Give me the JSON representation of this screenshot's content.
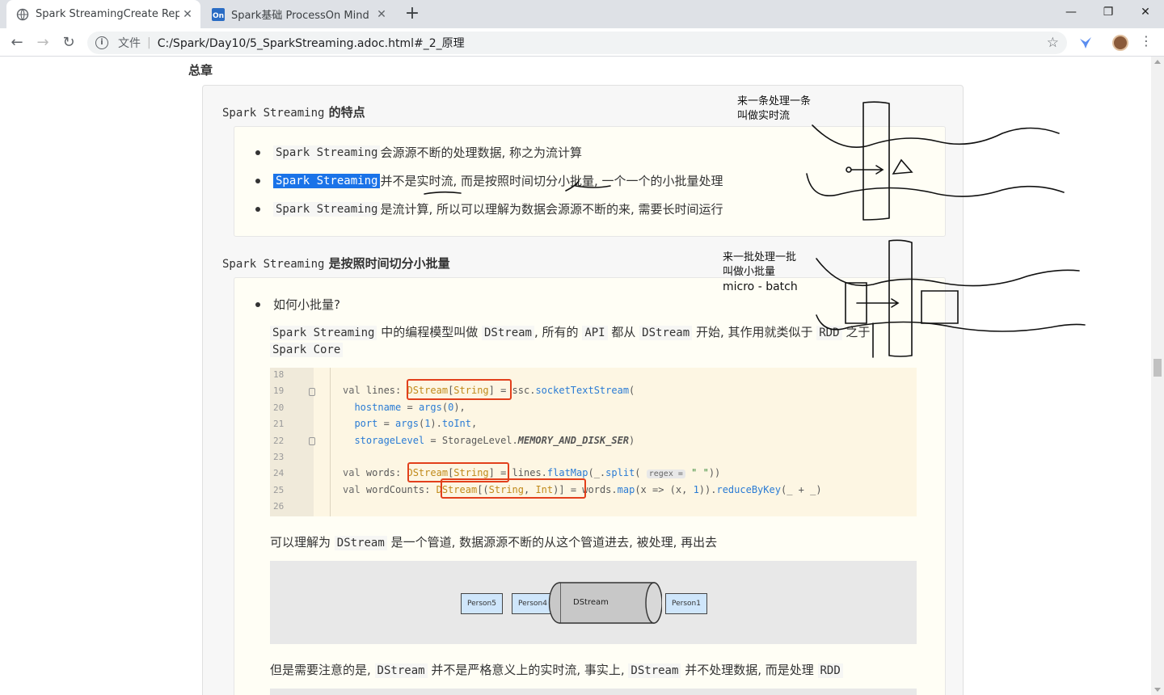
{
  "tabs": [
    {
      "title": "Spark StreamingCreate Reposi",
      "close": "✕"
    },
    {
      "title": "Spark基础 ProcessOn Mind",
      "close": "✕"
    }
  ],
  "newtab": "+",
  "window": {
    "min": "—",
    "max": "❐",
    "close": "✕"
  },
  "toolbar": {
    "file_label": "文件",
    "separator": "|",
    "url": "C:/Spark/Day10/5_SparkStreaming.adoc.html#_2_原理"
  },
  "page": {
    "top_heading": "总章",
    "section1": {
      "title_code": "Spark Streaming",
      "title_text": " 的特点",
      "bullets": [
        {
          "code": "Spark Streaming",
          "text": " 会源源不断的处理数据, 称之为流计算"
        },
        {
          "code": "Spark Streaming",
          "text": " 并不是实时流, 而是按照时间切分小批量, 一个一个的小批量处理"
        },
        {
          "code": "Spark Streaming",
          "text": " 是流计算, 所以可以理解为数据会源源不断的来, 需要长时间运行"
        }
      ]
    },
    "section2": {
      "title_code": "Spark Streaming",
      "title_text": " 是按照时间切分小批量",
      "bullet": "如何小批量?",
      "para1": {
        "c1": "Spark Streaming",
        "t1": " 中的编程模型叫做 ",
        "c2": "DStream",
        "t2": ", 所有的 ",
        "c3": "API",
        "t3": " 都从 ",
        "c4": "DStream",
        "t4": " 开始, 其作用就类似于 ",
        "c5": "RDD",
        "t5": " 之于",
        "c6": "Spark Core"
      },
      "code": {
        "lines": [
          {
            "n": "18",
            "text": ""
          },
          {
            "n": "19",
            "text": "val lines: DStream[String] = ssc.socketTextStream("
          },
          {
            "n": "20",
            "text": "  hostname = args(0),"
          },
          {
            "n": "21",
            "text": "  port = args(1).toInt,"
          },
          {
            "n": "22",
            "text": "  storageLevel = StorageLevel.MEMORY_AND_DISK_SER)"
          },
          {
            "n": "23",
            "text": ""
          },
          {
            "n": "24",
            "text": "val words: DStream[String] = lines.flatMap(_.split( regex = \" \"))"
          },
          {
            "n": "25",
            "text": "val wordCounts: DStream[(String, Int)] = words.map(x => (x, 1)).reduceByKey(_ + _)"
          },
          {
            "n": "26",
            "text": ""
          }
        ]
      },
      "para2": {
        "t1": "可以理解为 ",
        "c1": "DStream",
        "t2": " 是一个管道, 数据源源不断的从这个管道进去, 被处理, 再出去"
      },
      "diagram": {
        "p5": "Person5",
        "p4": "Person4",
        "pipe": "DStream",
        "p1": "Person1"
      },
      "para3": {
        "t1": "但是需要注意的是, ",
        "c1": "DStream",
        "t2": " 并不是严格意义上的实时流, 事实上, ",
        "c2": "DStream",
        "t3": " 并不处理数据, 而是处理 ",
        "c3": "RDD"
      }
    }
  },
  "annotations": {
    "a1_l1": "来一条处理一条",
    "a1_l2": "叫做实时流",
    "a2_l1": "来一批处理一批",
    "a2_l2": "叫做小批量",
    "a2_l3": "micro - batch"
  }
}
